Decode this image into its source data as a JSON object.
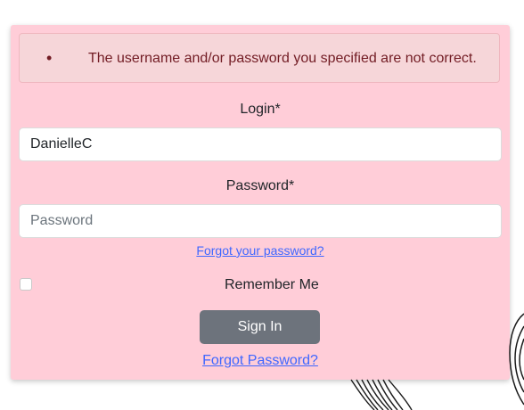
{
  "alert": {
    "bullet": "•",
    "message": "The username and/or password you specified are not correct.",
    "color": "#721c24",
    "background": "#f6d6d9"
  },
  "login": {
    "label": "Login*",
    "value": "DanielleC",
    "placeholder": ""
  },
  "password": {
    "label": "Password*",
    "value": "",
    "placeholder": "Password"
  },
  "forgot_small": "Forgot your password?",
  "remember_me": {
    "label": "Remember Me",
    "checked": false
  },
  "sign_in": "Sign In",
  "forgot_large": "Forgot Password?",
  "colors": {
    "card_background": "#ffcdd8",
    "button": "#6d737c",
    "link": "#3f67ff"
  },
  "decorations": [
    "sketch-illustration-bottom",
    "sketch-illustration-right"
  ]
}
